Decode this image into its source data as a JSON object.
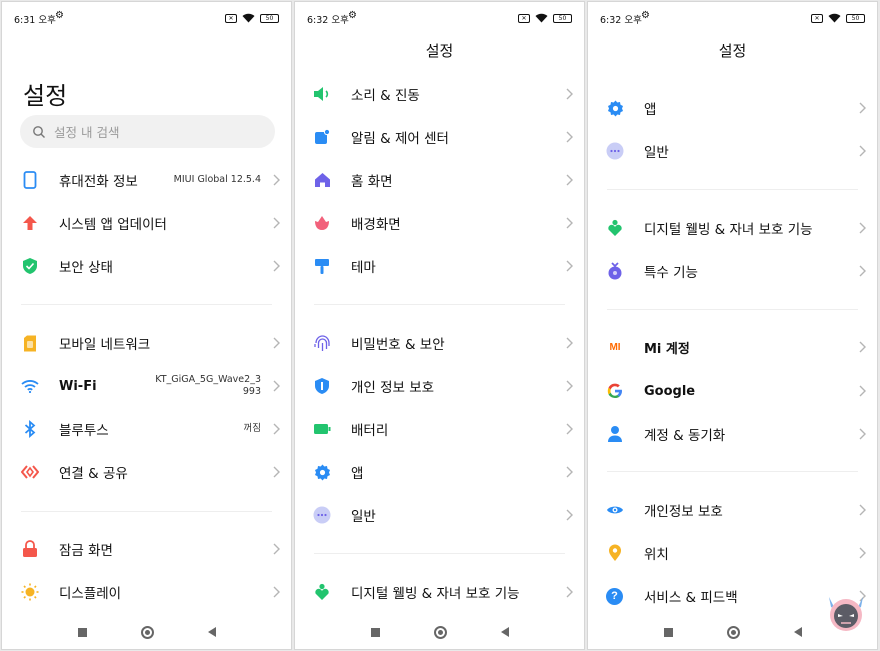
{
  "panels": [
    {
      "status": {
        "time": "6:31 오후",
        "badge": "✕",
        "battery": "50"
      },
      "title": "설정",
      "search": {
        "placeholder": "설정 내 검색"
      },
      "items": [
        {
          "label": "휴대전화 정보",
          "value": "MIUI Global 12.5.4",
          "icon": "phone-icon"
        },
        {
          "label": "시스템 앱 업데이터",
          "icon": "arrow-up-icon"
        },
        {
          "label": "보안 상태",
          "icon": "shield-check-icon"
        },
        {
          "label": "모바일 네트워크",
          "icon": "sim-card-icon"
        },
        {
          "label": "Wi-Fi",
          "value": "KT_GiGA_5G_Wave2_3 993",
          "value_line1": "KT_GiGA_5G_Wave2_3",
          "value_line2": "993",
          "icon": "wifi-icon"
        },
        {
          "label": "블루투스",
          "value": "꺼짐",
          "icon": "bluetooth-icon"
        },
        {
          "label": "연결 & 공유",
          "icon": "share-connection-icon"
        },
        {
          "label": "잠금 화면",
          "icon": "lock-icon"
        },
        {
          "label": "디스플레이",
          "icon": "sun-icon"
        }
      ]
    },
    {
      "status": {
        "time": "6:32 오후",
        "badge": "✕",
        "battery": "50"
      },
      "title": "설정",
      "items": [
        {
          "label": "소리 & 진동",
          "icon": "speaker-icon"
        },
        {
          "label": "알림 & 제어 센터",
          "icon": "notification-icon"
        },
        {
          "label": "홈 화면",
          "icon": "home-icon"
        },
        {
          "label": "배경화면",
          "icon": "wallpaper-flower-icon"
        },
        {
          "label": "테마",
          "icon": "paintbrush-icon"
        },
        {
          "label": "비밀번호 & 보안",
          "icon": "fingerprint-icon"
        },
        {
          "label": "개인 정보 보호",
          "icon": "privacy-shield-icon"
        },
        {
          "label": "배터리",
          "icon": "battery-icon"
        },
        {
          "label": "앱",
          "icon": "gear-icon"
        },
        {
          "label": "일반",
          "icon": "more-dots-icon"
        },
        {
          "label": "디지털 웰빙 & 자녀 보호 기능",
          "icon": "wellbeing-icon"
        }
      ]
    },
    {
      "status": {
        "time": "6:32 오후",
        "badge": "✕",
        "battery": "50"
      },
      "title": "설정",
      "items": [
        {
          "label": "앱",
          "icon": "gear-icon"
        },
        {
          "label": "일반",
          "icon": "more-dots-icon"
        },
        {
          "label": "디지털 웰빙 & 자녀 보호 기능",
          "icon": "wellbeing-icon"
        },
        {
          "label": "특수 기능",
          "icon": "accessibility-icon"
        },
        {
          "label": "Mi 계정",
          "icon": "mi-logo-icon",
          "logo_text": "MI"
        },
        {
          "label": "Google",
          "icon": "google-icon",
          "logo_text": "G"
        },
        {
          "label": "계정 & 동기화",
          "icon": "account-person-icon"
        },
        {
          "label": "개인정보 보호",
          "icon": "eye-icon"
        },
        {
          "label": "위치",
          "icon": "location-pin-icon"
        },
        {
          "label": "서비스 & 피드백",
          "icon": "help-icon",
          "logo_text": "?"
        }
      ]
    }
  ],
  "colors": {
    "blue": "#2a8cf4",
    "red": "#f4574b",
    "green": "#22c46e",
    "yellow": "#f6b324",
    "purple": "#6e62e8",
    "pink": "#f2617b",
    "text": "#111111",
    "chevron": "#b5b5b5"
  }
}
